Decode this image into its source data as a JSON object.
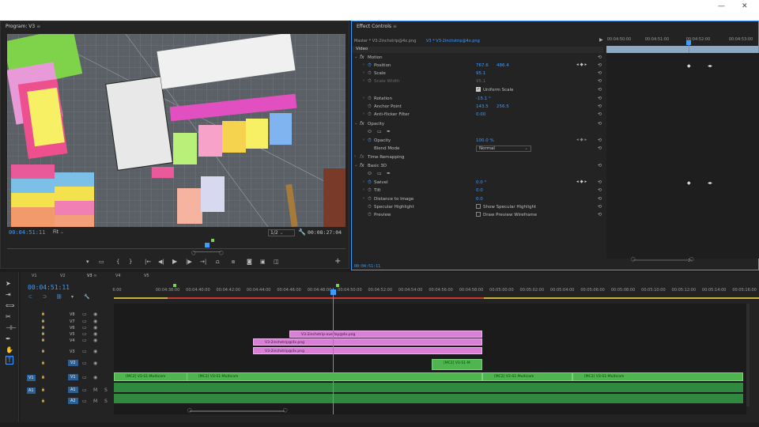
{
  "window": {
    "minimize": "—",
    "close": "✕"
  },
  "program": {
    "title": "Program: V3",
    "timecode_left": "00:04:51:11",
    "fit": "Fit",
    "resolution": "1/2",
    "timecode_right": "00:08:27:04",
    "controls": [
      "{",
      "}",
      "|←",
      "◀|",
      "▶",
      "|▶",
      "→|"
    ]
  },
  "effect_controls": {
    "title": "Effect Controls",
    "master": "Master * V3-2inchstrip@4x.png",
    "clip": "V3 * V3-2inchstrip@4x.png",
    "section_video": "Video",
    "ruler": [
      "00:04:50:00",
      "00:04:51:00",
      "00:04:52:00",
      "00:04:53:00"
    ],
    "timecode": "00:04:51:11",
    "rows": {
      "motion": "Motion",
      "position": "Position",
      "position_x": "767.6",
      "position_y": "486.4",
      "scale": "Scale",
      "scale_v": "95.1",
      "scale_width": "Scale Width",
      "scale_width_v": "95.1",
      "uniform": "Uniform Scale",
      "rotation": "Rotation",
      "rotation_v": "-15.1 °",
      "anchor": "Anchor Point",
      "anchor_x": "143.5",
      "anchor_y": "256.5",
      "antiflicker": "Anti-flicker Filter",
      "antiflicker_v": "0.00",
      "opacity_group": "Opacity",
      "opacity": "Opacity",
      "opacity_v": "100.0 %",
      "blend": "Blend Mode",
      "blend_v": "Normal",
      "time_remap": "Time Remapping",
      "basic3d": "Basic 3D",
      "swivel": "Swivel",
      "swivel_v": "0.0 °",
      "tilt": "Tilt",
      "tilt_v": "0.0",
      "distance": "Distance to Image",
      "distance_v": "0.0",
      "specular": "Specular Highlight",
      "specular_v": "Show Specular Highlight",
      "preview": "Preview",
      "preview_v": "Draw Preview Wireframe"
    }
  },
  "timeline": {
    "timecode": "00:04:51:11",
    "track_tabs": [
      "V1",
      "V2",
      "V3",
      "V4",
      "V5"
    ],
    "ruler": [
      "00:04:38:00",
      "00:04:40:00",
      "00:04:42:00",
      "00:04:44:00",
      "00:04:46:00",
      "00:04:48:00",
      "00:04:50:00",
      "00:04:52:00",
      "00:04:54:00",
      "00:04:56:00",
      "00:04:58:00",
      "00:05:00:00",
      "00:05:02:00",
      "00:05:04:00",
      "00:05:06:00",
      "00:05:08:00",
      "00:05:10:00",
      "00:05:12:00",
      "00:05:14:00",
      "00:05:16:00",
      "00:05:18:00"
    ],
    "ruler_first": "6:00",
    "tracks": [
      {
        "name": "V8"
      },
      {
        "name": "V7"
      },
      {
        "name": "V6"
      },
      {
        "name": "V5"
      },
      {
        "name": "V4"
      },
      {
        "name": "V3"
      },
      {
        "name": "V2"
      },
      {
        "name": "V1"
      },
      {
        "name": "A1"
      },
      {
        "name": "A2"
      }
    ],
    "src_v": "V1",
    "src_a": "A1",
    "clips": {
      "v5": "V3-2inchstrip-overlay@4x.png",
      "v4": "V3-2inchstrip@4x.png",
      "v3": "V3-2inchstrip@4x.png",
      "v2": "[MC2] V3-S1-M",
      "v1_a": "[MC2] V3-S1-Multicam",
      "v1_b": "[MC2] V3-S1-Multicam",
      "v1_c": "[MC2] V3-S1-Multicam",
      "v1_d": "[MC2] V3-S1-Multicam"
    },
    "audio_labels": {
      "m": "M",
      "s": "S"
    }
  },
  "colors": {
    "accent": "#3f9cff",
    "pink": "#d97fd8",
    "green": "#4fb64f",
    "panel": "#232323"
  }
}
